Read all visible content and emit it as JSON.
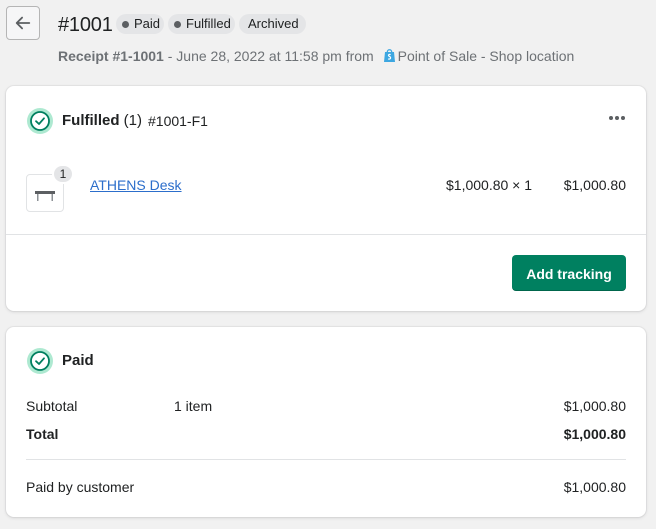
{
  "header": {
    "order_number": "#1001",
    "badges": {
      "paid": "Paid",
      "fulfilled": "Fulfilled",
      "archived": "Archived"
    },
    "receipt_label": "Receipt #1-1001",
    "receipt_detail": " - June 28, 2022 at 11:58 pm from ",
    "source": "Point of Sale - Shop location"
  },
  "fulfilled_card": {
    "title": "Fulfilled",
    "count": "(1)",
    "fulfillment_id": "#1001-F1",
    "line_item": {
      "quantity": "1",
      "product_name": "ATHENS Desk",
      "unit_price": "$1,000.80 × 1",
      "total": "$1,000.80"
    },
    "add_tracking_label": "Add tracking"
  },
  "paid_card": {
    "title": "Paid",
    "subtotal_label": "Subtotal",
    "subtotal_items": "1 item",
    "subtotal_value": "$1,000.80",
    "total_label": "Total",
    "total_value": "$1,000.80",
    "paid_by_label": "Paid by customer",
    "paid_by_value": "$1,000.80"
  },
  "colors": {
    "primary_button": "#008060",
    "link": "#2c6ecb",
    "success_ring": "#aee9d1",
    "success_check": "#007f5f"
  },
  "icons": [
    "arrow-left-icon",
    "status-dot-icon",
    "shopify-bag-icon",
    "circle-check-icon",
    "ellipsis-icon",
    "product-thumbnail"
  ]
}
